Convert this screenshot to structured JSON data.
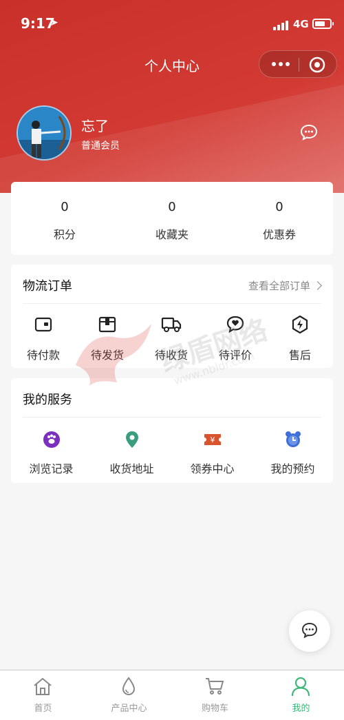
{
  "status_bar": {
    "time": "9:17",
    "network": "4G"
  },
  "header": {
    "title": "个人中心"
  },
  "profile": {
    "name": "忘了",
    "level": "普通会员"
  },
  "stats": [
    {
      "value": "0",
      "label": "积分"
    },
    {
      "value": "0",
      "label": "收藏夹"
    },
    {
      "value": "0",
      "label": "优惠券"
    }
  ],
  "orders": {
    "title": "物流订单",
    "view_all": "查看全部订单",
    "items": [
      {
        "label": "待付款",
        "icon": "wallet-icon"
      },
      {
        "label": "待发货",
        "icon": "package-icon"
      },
      {
        "label": "待收货",
        "icon": "truck-icon"
      },
      {
        "label": "待评价",
        "icon": "heart-chat-icon"
      },
      {
        "label": "售后",
        "icon": "lightning-shield-icon"
      }
    ]
  },
  "services": {
    "title": "我的服务",
    "items": [
      {
        "label": "浏览记录",
        "icon": "paw-icon",
        "color": "#7b2fbf"
      },
      {
        "label": "收货地址",
        "icon": "location-pin-icon",
        "color": "#3a9d7f"
      },
      {
        "label": "领券中心",
        "icon": "coupon-icon",
        "color": "#d9532c"
      },
      {
        "label": "我的预约",
        "icon": "alarm-clock-icon",
        "color": "#3e6fd8"
      }
    ]
  },
  "watermark": {
    "text": "绿盾网络",
    "url": "www.nbldr.com"
  },
  "tabbar": {
    "items": [
      {
        "label": "首页",
        "icon": "home-icon"
      },
      {
        "label": "产品中心",
        "icon": "drop-icon"
      },
      {
        "label": "购物车",
        "icon": "cart-icon"
      },
      {
        "label": "我的",
        "icon": "user-icon",
        "active": true
      }
    ]
  },
  "colors": {
    "primary": "#c9302a",
    "active_tab": "#3cb878"
  }
}
